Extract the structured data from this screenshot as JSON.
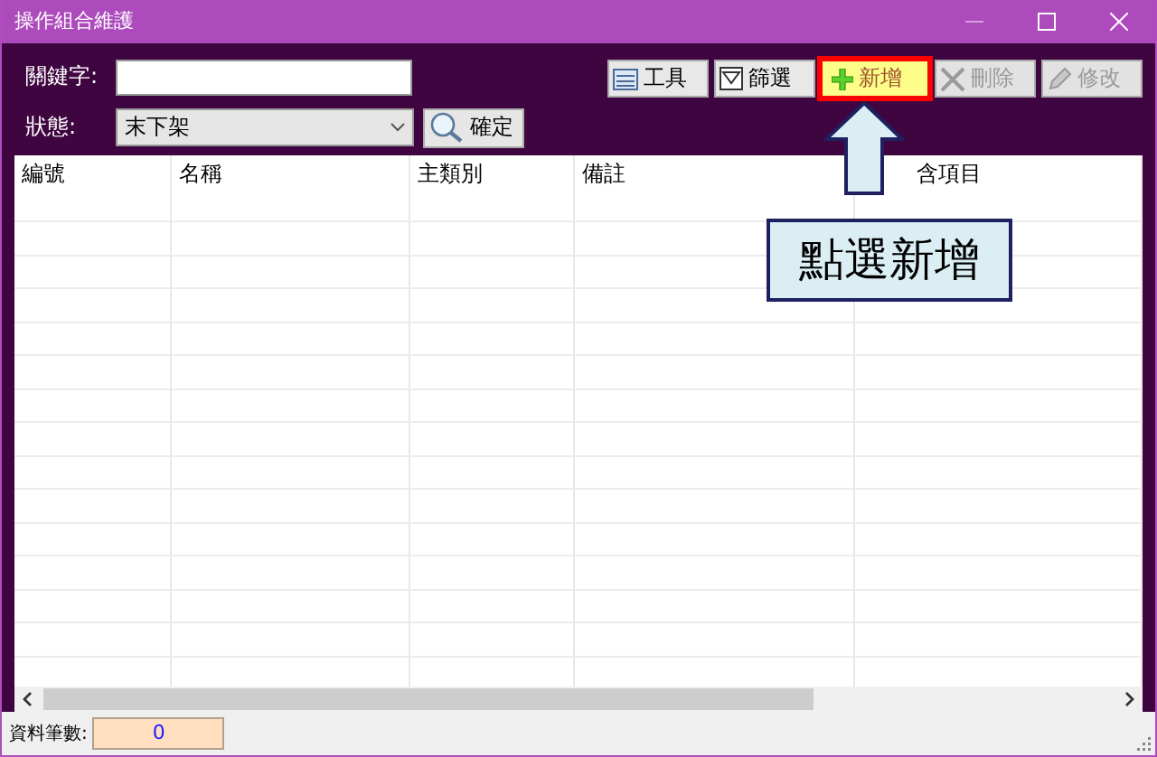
{
  "window": {
    "title": "操作組合維護"
  },
  "filters": {
    "keyword_label": "關鍵字:",
    "status_label": "狀態:",
    "status": {
      "value": "末下架"
    },
    "confirm_button": "確定"
  },
  "toolbar": [
    {
      "kind": "tools",
      "label": "工具",
      "disabled": false,
      "highlighted": false
    },
    {
      "kind": "filter",
      "label": "篩選",
      "disabled": false,
      "highlighted": false
    },
    {
      "kind": "add",
      "label": "新增",
      "disabled": false,
      "highlighted": true
    },
    {
      "kind": "delete",
      "label": "刪除",
      "disabled": true,
      "highlighted": false
    },
    {
      "kind": "edit",
      "label": "修改",
      "disabled": true,
      "highlighted": false
    }
  ],
  "table": {
    "columns": [
      "編號",
      "名稱",
      "主類別",
      "備註",
      "含項目"
    ]
  },
  "callout": {
    "text": "點選新增"
  },
  "status_bar": {
    "label": "資料筆數:",
    "count": "0"
  }
}
